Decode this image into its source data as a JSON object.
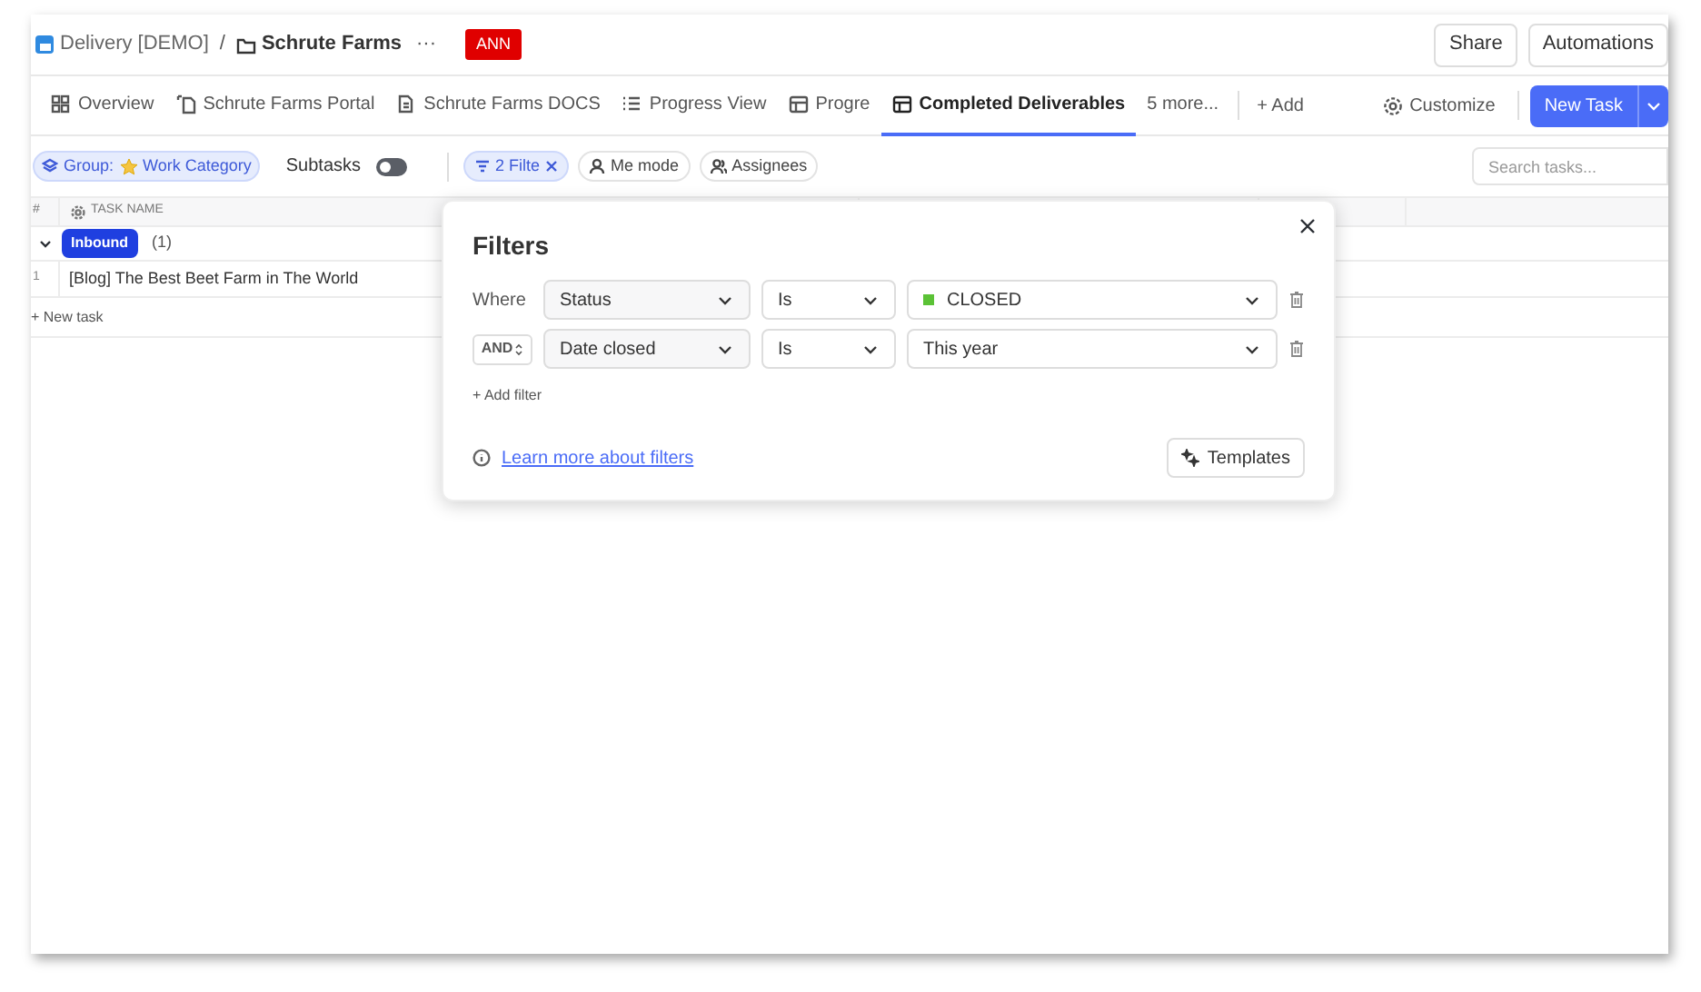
{
  "breadcrumb": [
    {
      "kind": "space",
      "text": "Delivery [DEMO]"
    },
    {
      "kind": "folder",
      "text": "Schrute Farms"
    }
  ],
  "breadcrumb_separator": "/",
  "more": "···",
  "badge": "ANN",
  "header_buttons": [
    "Share",
    "Automations"
  ],
  "tabs": [
    {
      "kind": "overview",
      "label": "Overview",
      "selected": false
    },
    {
      "kind": "portal",
      "label": "Schrute Farms Portal",
      "selected": false
    },
    {
      "kind": "doc",
      "label": "Schrute Farms DOCS",
      "selected": false
    },
    {
      "kind": "list",
      "label": "Progress View",
      "selected": false
    },
    {
      "kind": "table",
      "label": "Progre",
      "selected": false
    },
    {
      "kind": "table",
      "label": "Completed Deliverables",
      "selected": true
    },
    {
      "kind": "plain",
      "label": "5 more...",
      "selected": false
    }
  ],
  "add_view": "+ Add",
  "customize": "Customize",
  "new_task": "New Task",
  "toolbar": {
    "group_prefix": "Group:",
    "group_value": "Work Category",
    "subtasks": {
      "label": "Subtasks",
      "on": false
    },
    "filter_chip": "2 Filte",
    "me_mode": "Me mode",
    "assignees": "Assignees",
    "search": {
      "placeholder": "Search tasks..."
    }
  },
  "table": {
    "columns": [
      "#",
      "TASK NAME"
    ],
    "group": {
      "label": "Inbound",
      "count": "(1)",
      "expanded": true
    },
    "rows": [
      {
        "number": "1",
        "name": "[Blog] The Best Beet Farm in The World"
      }
    ],
    "new_task": "+ New task"
  },
  "filters": {
    "title": "Filters",
    "rows": [
      {
        "lead": {
          "kind": "label",
          "text": "Where"
        },
        "field": "Status",
        "operator": "Is",
        "value": {
          "text": "CLOSED",
          "color": "#5bc236"
        }
      },
      {
        "lead": {
          "kind": "select",
          "text": "AND"
        },
        "field": "Date closed",
        "operator": "Is",
        "value": {
          "text": "This year"
        }
      }
    ],
    "add_filter": "+ Add filter",
    "learn_more": "Learn more about filters",
    "templates": "Templates"
  }
}
